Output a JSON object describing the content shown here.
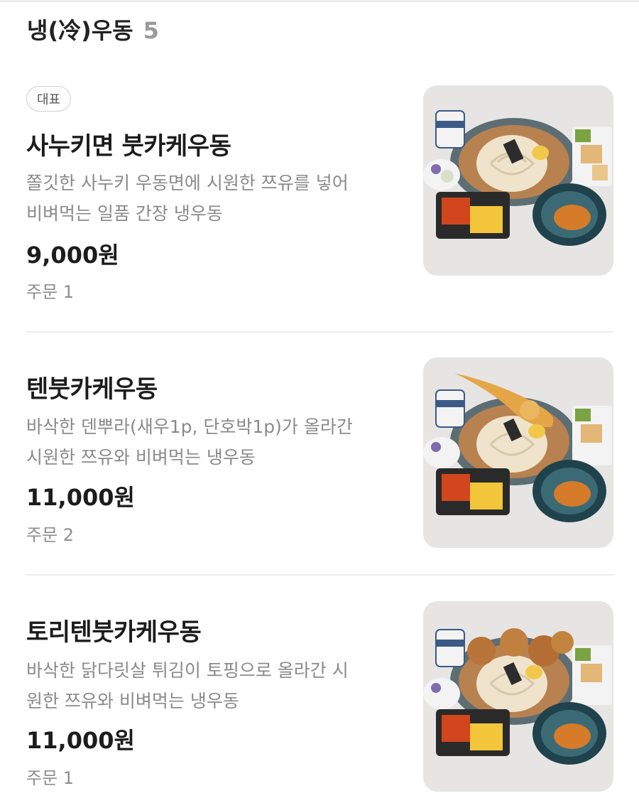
{
  "section": {
    "title": "냉(冷)우동",
    "count": "5"
  },
  "items": [
    {
      "badge": "대표",
      "name": "사누키면 붓카케우동",
      "desc_line1": "쫄깃한 사누키 우동면에 시원한 쯔유를 넣어",
      "desc_line2": "비벼먹는 일품 간장 냉우동",
      "price": "9,000원",
      "orders": "주문 1"
    },
    {
      "name": "텐붓카케우동",
      "desc_line1": "바삭한 덴뿌라(새우1p, 단호박1p)가 올라간",
      "desc_line2": "시원한 쯔유와 비벼먹는 냉우동",
      "price": "11,000원",
      "orders": "주문 2"
    },
    {
      "name": "토리텐붓카케우동",
      "desc_line1": "바삭한 닭다릿살 튀김이 토핑으로 올라간 시",
      "desc_line2": "원한 쯔유와 비벼먹는 냉우동",
      "price": "11,000원",
      "orders": "주문 1"
    }
  ]
}
